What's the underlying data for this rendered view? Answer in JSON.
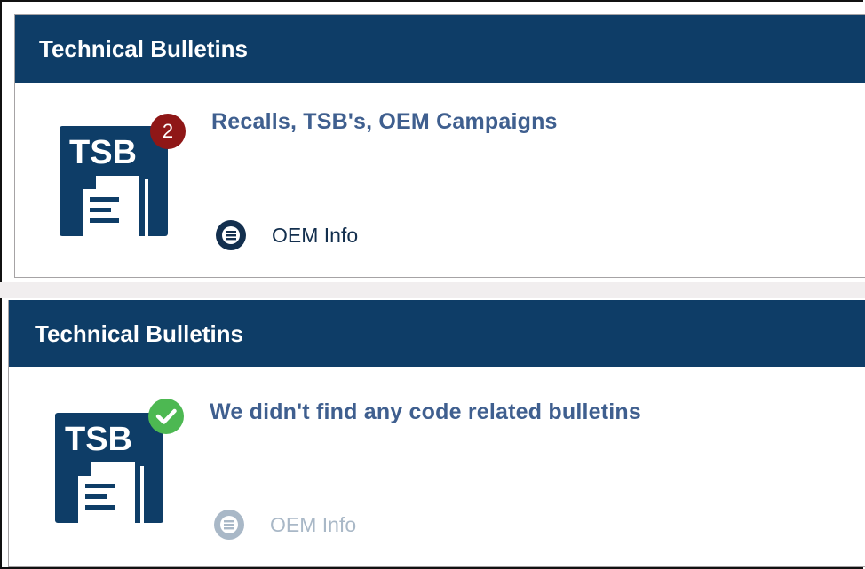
{
  "cards": [
    {
      "header": "Technical Bulletins",
      "tsb_label": "TSB",
      "badge": "2",
      "badge_color": "#8f1717",
      "title": "Recalls, TSB's, OEM Campaigns",
      "oem_label": "OEM Info",
      "oem_state": "enabled"
    },
    {
      "header": "Technical Bulletins",
      "tsb_label": "TSB",
      "badge_icon": "check-icon",
      "badge_color": "#4db852",
      "title": "We didn't find any code related bulletins",
      "oem_label": "OEM Info",
      "oem_state": "disabled"
    }
  ],
  "colors": {
    "header_bg": "#0e3d67",
    "title_text": "#3f5f8f",
    "oem_active": "#132f4e",
    "oem_disabled": "#a9b8c7"
  }
}
